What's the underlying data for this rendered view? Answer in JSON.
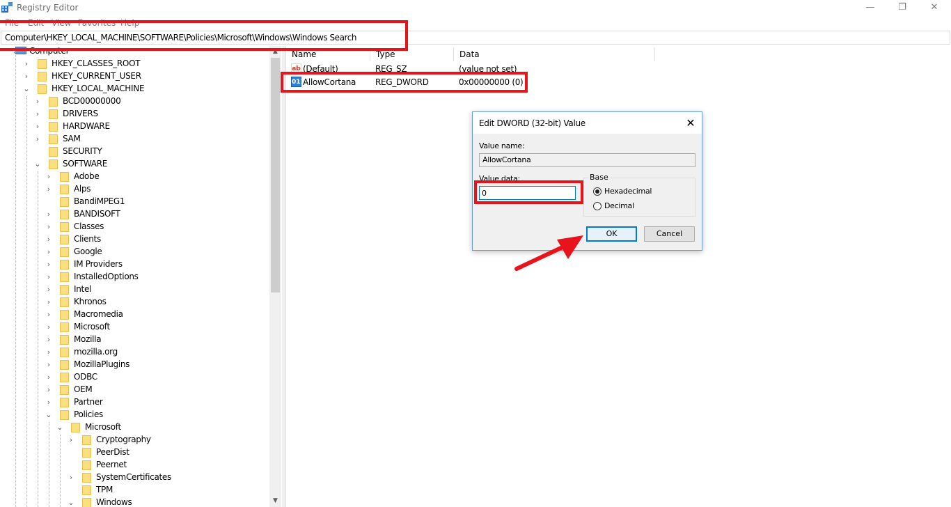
{
  "window": {
    "title": "Registry Editor",
    "minimize_glyph": "—",
    "maximize_glyph": "❐",
    "close_glyph": "✕"
  },
  "menu": [
    "File",
    "Edit",
    "View",
    "Favorites",
    "Help"
  ],
  "address": "Computer\\HKEY_LOCAL_MACHINE\\SOFTWARE\\Policies\\Microsoft\\Windows\\Windows Search",
  "tree": [
    {
      "label": "Computer",
      "depth": 0,
      "expander": "open",
      "icon": "computer-icon"
    },
    {
      "label": "HKEY_CLASSES_ROOT",
      "depth": 1,
      "expander": "closed"
    },
    {
      "label": "HKEY_CURRENT_USER",
      "depth": 1,
      "expander": "closed"
    },
    {
      "label": "HKEY_LOCAL_MACHINE",
      "depth": 1,
      "expander": "open"
    },
    {
      "label": "BCD00000000",
      "depth": 2,
      "expander": "closed"
    },
    {
      "label": "DRIVERS",
      "depth": 2,
      "expander": "closed"
    },
    {
      "label": "HARDWARE",
      "depth": 2,
      "expander": "closed"
    },
    {
      "label": "SAM",
      "depth": 2,
      "expander": "closed"
    },
    {
      "label": "SECURITY",
      "depth": 2,
      "expander": "none"
    },
    {
      "label": "SOFTWARE",
      "depth": 2,
      "expander": "open"
    },
    {
      "label": "Adobe",
      "depth": 3,
      "expander": "closed"
    },
    {
      "label": "Alps",
      "depth": 3,
      "expander": "closed"
    },
    {
      "label": "BandiMPEG1",
      "depth": 3,
      "expander": "none"
    },
    {
      "label": "BANDISOFT",
      "depth": 3,
      "expander": "closed"
    },
    {
      "label": "Classes",
      "depth": 3,
      "expander": "closed"
    },
    {
      "label": "Clients",
      "depth": 3,
      "expander": "closed"
    },
    {
      "label": "Google",
      "depth": 3,
      "expander": "closed"
    },
    {
      "label": "IM Providers",
      "depth": 3,
      "expander": "closed"
    },
    {
      "label": "InstalledOptions",
      "depth": 3,
      "expander": "closed"
    },
    {
      "label": "Intel",
      "depth": 3,
      "expander": "closed"
    },
    {
      "label": "Khronos",
      "depth": 3,
      "expander": "closed"
    },
    {
      "label": "Macromedia",
      "depth": 3,
      "expander": "closed"
    },
    {
      "label": "Microsoft",
      "depth": 3,
      "expander": "closed"
    },
    {
      "label": "Mozilla",
      "depth": 3,
      "expander": "closed"
    },
    {
      "label": "mozilla.org",
      "depth": 3,
      "expander": "closed"
    },
    {
      "label": "MozillaPlugins",
      "depth": 3,
      "expander": "closed"
    },
    {
      "label": "ODBC",
      "depth": 3,
      "expander": "closed"
    },
    {
      "label": "OEM",
      "depth": 3,
      "expander": "closed"
    },
    {
      "label": "Partner",
      "depth": 3,
      "expander": "closed"
    },
    {
      "label": "Policies",
      "depth": 3,
      "expander": "open"
    },
    {
      "label": "Microsoft",
      "depth": 4,
      "expander": "open"
    },
    {
      "label": "Cryptography",
      "depth": 5,
      "expander": "closed"
    },
    {
      "label": "PeerDist",
      "depth": 5,
      "expander": "none"
    },
    {
      "label": "Peernet",
      "depth": 5,
      "expander": "none"
    },
    {
      "label": "SystemCertificates",
      "depth": 5,
      "expander": "closed"
    },
    {
      "label": "TPM",
      "depth": 5,
      "expander": "none"
    },
    {
      "label": "Windows",
      "depth": 5,
      "expander": "open"
    }
  ],
  "columns": {
    "name": "Name",
    "type": "Type",
    "data": "Data"
  },
  "values": [
    {
      "name": "(Default)",
      "type": "REG_SZ",
      "data": "(value not set)",
      "icon": "string-value-icon",
      "glyph": "ab"
    },
    {
      "name": "AllowCortana",
      "type": "REG_DWORD",
      "data": "0x00000000 (0)",
      "icon": "dword-value-icon",
      "glyph": "011"
    }
  ],
  "dialog": {
    "title": "Edit DWORD (32-bit) Value",
    "close_glyph": "✕",
    "value_name_label": "Value name:",
    "value_name": "AllowCortana",
    "value_data_label": "Value data:",
    "value_data": "0",
    "base_label": "Base",
    "hex_label": "Hexadecimal",
    "dec_label": "Decimal",
    "base_selected": "Hexadecimal",
    "ok_label": "OK",
    "cancel_label": "Cancel"
  },
  "annotation_color": "#e8141b"
}
